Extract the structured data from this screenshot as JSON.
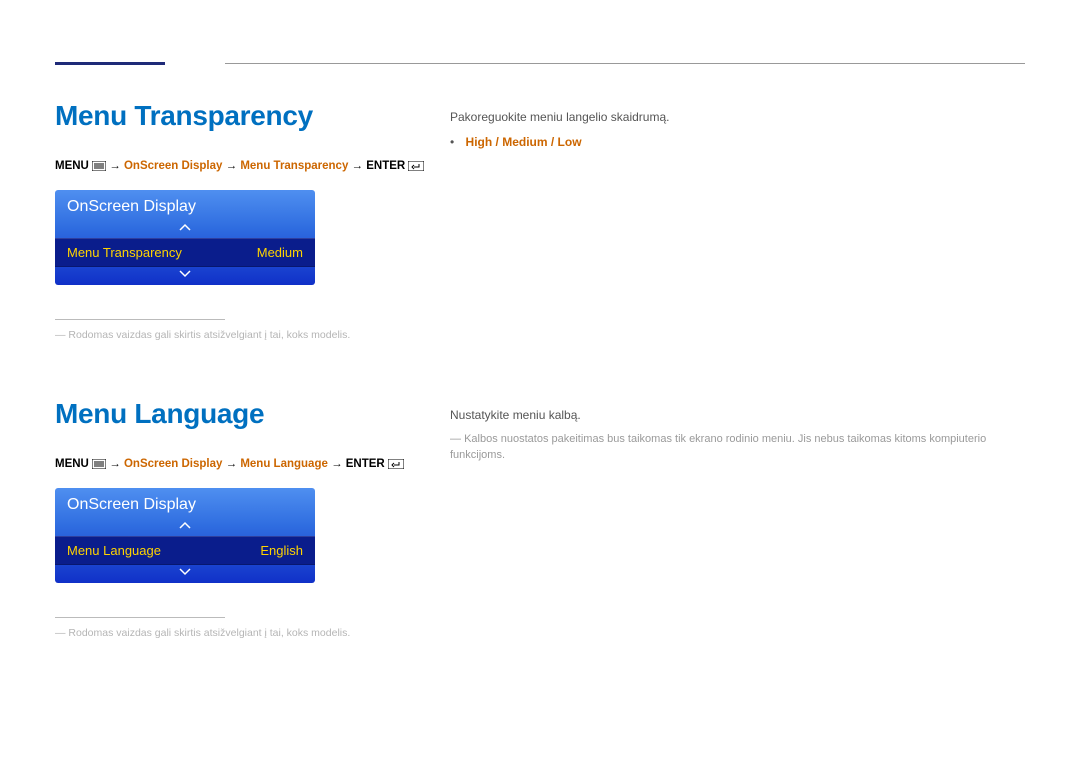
{
  "section1": {
    "title": "Menu Transparency",
    "breadcrumb": {
      "menu": "MENU",
      "path1": "OnScreen Display",
      "path2": "Menu Transparency",
      "enter": "ENTER"
    },
    "panel": {
      "header": "OnScreen Display",
      "item_label": "Menu Transparency",
      "item_value": "Medium"
    },
    "footnote": "Rodomas vaizdas gali skirtis atsižvelgiant į tai, koks modelis.",
    "desc": "Pakoreguokite meniu langelio skaidrumą.",
    "options": "High / Medium / Low"
  },
  "section2": {
    "title": "Menu Language",
    "breadcrumb": {
      "menu": "MENU",
      "path1": "OnScreen Display",
      "path2": "Menu Language",
      "enter": "ENTER"
    },
    "panel": {
      "header": "OnScreen Display",
      "item_label": "Menu Language",
      "item_value": "English"
    },
    "footnote": "Rodomas vaizdas gali skirtis atsižvelgiant į tai, koks modelis.",
    "desc": "Nustatykite meniu kalbą.",
    "note": "Kalbos nuostatos pakeitimas bus taikomas tik ekrano rodinio meniu. Jis nebus taikomas kitoms kompiuterio funkcijoms."
  }
}
